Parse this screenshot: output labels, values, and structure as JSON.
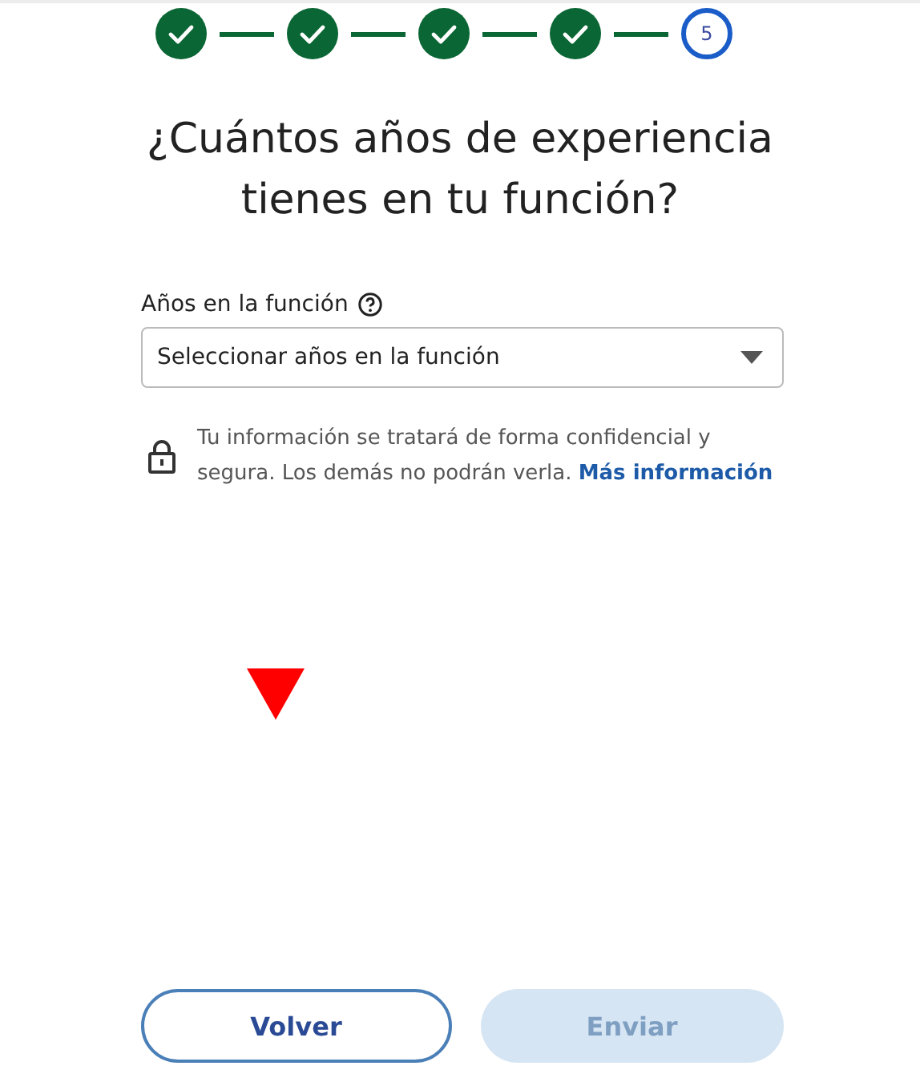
{
  "steps": [
    {
      "done": true
    },
    {
      "done": true
    },
    {
      "done": true
    },
    {
      "done": true
    },
    {
      "done": false,
      "label": "5"
    }
  ],
  "title": "¿Cuántos años de experiencia tienes en tu función?",
  "field": {
    "label": "Años en la función",
    "placeholder": "Seleccionar años en la función"
  },
  "notice": {
    "text": "Tu información se tratará de forma confidencial y segura. Los demás no podrán verla.",
    "link": "Más información"
  },
  "buttons": [
    {
      "label": "Volver",
      "disabled": false
    },
    {
      "label": "Enviar",
      "disabled": true
    }
  ]
}
